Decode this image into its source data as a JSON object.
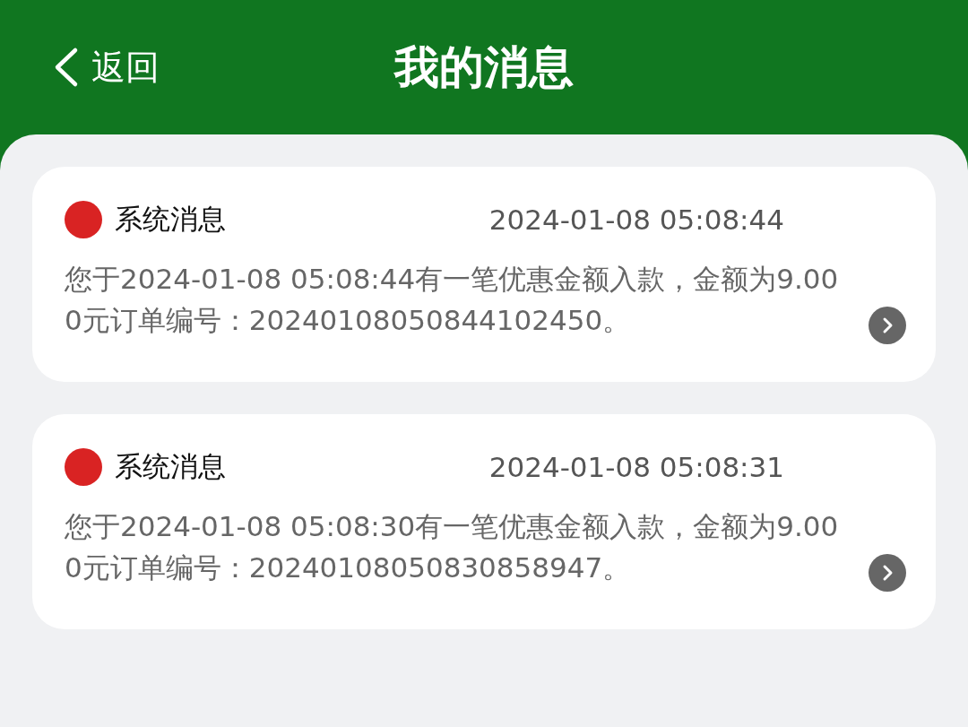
{
  "header": {
    "back_label": "返回",
    "title": "我的消息"
  },
  "messages": [
    {
      "unread": true,
      "color": "#d92323",
      "title": "系统消息",
      "time": "2024-01-08 05:08:44",
      "body": "您于2024-01-08 05:08:44有一笔优惠金额入款，金额为9.000元订单编号：20240108050844102450。"
    },
    {
      "unread": true,
      "color": "#d92323",
      "title": "系统消息",
      "time": "2024-01-08 05:08:31",
      "body": "您于2024-01-08 05:08:30有一笔优惠金额入款，金额为9.000元订单编号：20240108050830858947。"
    }
  ]
}
